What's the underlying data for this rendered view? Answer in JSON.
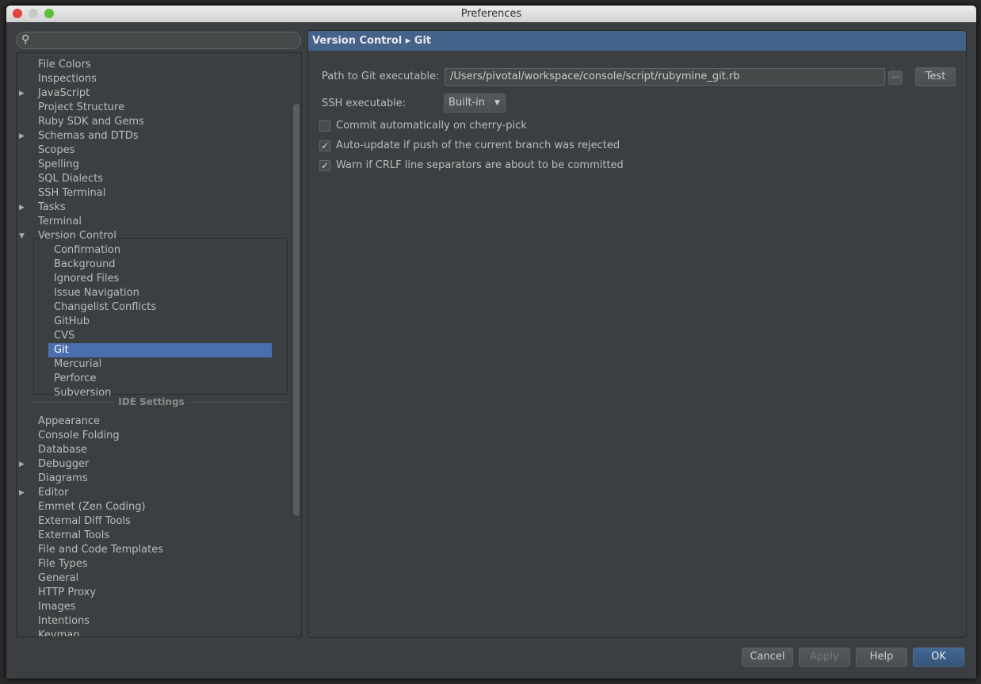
{
  "window": {
    "title": "Preferences"
  },
  "tree": {
    "top_items": [
      {
        "label": "File Colors",
        "arrow": false
      },
      {
        "label": "Inspections",
        "arrow": false
      },
      {
        "label": "JavaScript",
        "arrow": true
      },
      {
        "label": "Project Structure",
        "arrow": false
      },
      {
        "label": "Ruby SDK and Gems",
        "arrow": false
      },
      {
        "label": "Schemas and DTDs",
        "arrow": true
      },
      {
        "label": "Scopes",
        "arrow": false
      },
      {
        "label": "Spelling",
        "arrow": false
      },
      {
        "label": "SQL Dialects",
        "arrow": false
      },
      {
        "label": "SSH Terminal",
        "arrow": false
      },
      {
        "label": "Tasks",
        "arrow": true
      },
      {
        "label": "Terminal",
        "arrow": false
      },
      {
        "label": "Version Control",
        "arrow": true,
        "expanded": true
      }
    ],
    "vc_children": [
      "Confirmation",
      "Background",
      "Ignored Files",
      "Issue Navigation",
      "Changelist Conflicts",
      "GitHub",
      "CVS",
      "Git",
      "Mercurial",
      "Perforce",
      "Subversion"
    ],
    "selected": "Git",
    "section_label": "IDE Settings",
    "ide_items": [
      {
        "label": "Appearance",
        "arrow": false
      },
      {
        "label": "Console Folding",
        "arrow": false
      },
      {
        "label": "Database",
        "arrow": false
      },
      {
        "label": "Debugger",
        "arrow": true
      },
      {
        "label": "Diagrams",
        "arrow": false
      },
      {
        "label": "Editor",
        "arrow": true
      },
      {
        "label": "Emmet (Zen Coding)",
        "arrow": false
      },
      {
        "label": "External Diff Tools",
        "arrow": false
      },
      {
        "label": "External Tools",
        "arrow": false
      },
      {
        "label": "File and Code Templates",
        "arrow": false
      },
      {
        "label": "File Types",
        "arrow": false
      },
      {
        "label": "General",
        "arrow": false
      },
      {
        "label": "HTTP Proxy",
        "arrow": false
      },
      {
        "label": "Images",
        "arrow": false
      },
      {
        "label": "Intentions",
        "arrow": false
      },
      {
        "label": "Keymap",
        "arrow": false
      }
    ]
  },
  "panel": {
    "breadcrumb": "Version Control ▸ Git",
    "path_label": "Path to Git executable:",
    "path_value": "/Users/pivotal/workspace/console/script/rubymine_git.rb",
    "browse_label": "...",
    "test_label": "Test",
    "ssh_label": "SSH executable:",
    "ssh_value": "Built-in",
    "checkboxes": [
      {
        "label": "Commit automatically on cherry-pick",
        "checked": false
      },
      {
        "label": "Auto-update if push of the current branch was rejected",
        "checked": true
      },
      {
        "label": "Warn if CRLF line separators are about to be committed",
        "checked": true
      }
    ]
  },
  "buttons": {
    "cancel": "Cancel",
    "apply": "Apply",
    "help": "Help",
    "ok": "OK"
  },
  "colors": {
    "header": "#45628a",
    "selection": "#4b6eaf",
    "ok": "#3d5a80"
  }
}
